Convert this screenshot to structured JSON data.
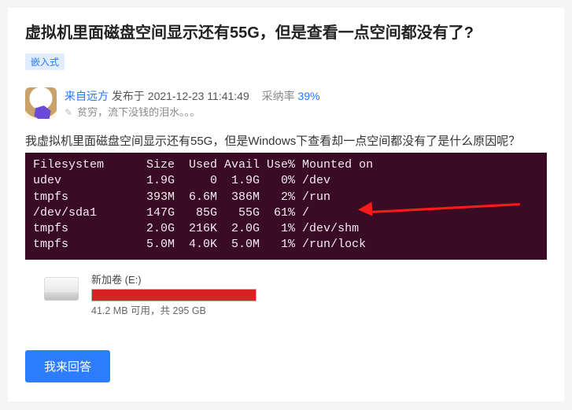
{
  "question": {
    "title": "虚拟机里面磁盘空间显示还有55G，但是查看一点空间都没有了?",
    "tag": "嵌入式"
  },
  "author": {
    "name": "来自远方",
    "publish_prefix": "发布于",
    "publish_time": "2021-12-23 11:41:49",
    "adopt_label": "采纳率",
    "adopt_rate": "39%",
    "signature": "贫穷，流下没钱的泪水。。。"
  },
  "body": {
    "intro": "我虚拟机里面磁盘空间显示还有55G，但是Windows下查看却一点空间都没有了是什么原因呢？"
  },
  "terminal": {
    "header": "Filesystem      Size  Used Avail Use% Mounted on",
    "rows": [
      "udev            1.9G     0  1.9G   0% /dev",
      "tmpfs           393M  6.6M  386M   2% /run",
      "/dev/sda1       147G   85G   55G  61% /",
      "tmpfs           2.0G  216K  2.0G   1% /dev/shm",
      "tmpfs           5.0M  4.0K  5.0M   1% /run/lock"
    ]
  },
  "drive": {
    "name": "新加卷 (E:)",
    "status": "41.2 MB 可用，共 295 GB",
    "fill_percent": 99.8
  },
  "actions": {
    "answer": "我来回答"
  }
}
